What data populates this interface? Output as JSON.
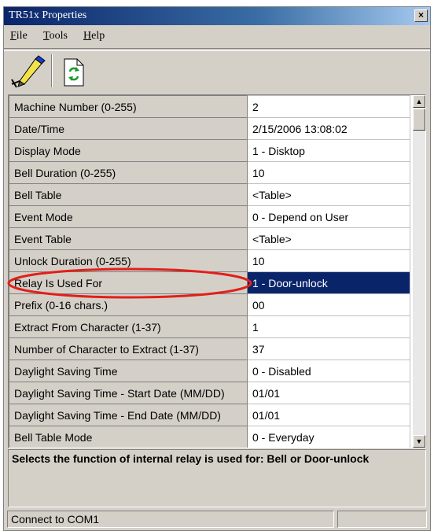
{
  "window": {
    "title": "TR51x Properties",
    "close_label": "×"
  },
  "menu": {
    "file_first": "F",
    "file_rest": "ile",
    "tools_first": "T",
    "tools_rest": "ools",
    "help_first": "H",
    "help_rest": "elp"
  },
  "toolbar": {
    "write_icon": "pen-writing-icon",
    "refresh_icon": "refresh-document-icon"
  },
  "properties": [
    {
      "name": "Machine Number (0-255)",
      "value": "2"
    },
    {
      "name": "Date/Time",
      "value": "2/15/2006 13:08:02"
    },
    {
      "name": "Display Mode",
      "value": "1 - Disktop"
    },
    {
      "name": "Bell Duration (0-255)",
      "value": "10"
    },
    {
      "name": "Bell Table",
      "value": "<Table>"
    },
    {
      "name": "Event Mode",
      "value": "0 - Depend on User"
    },
    {
      "name": "Event Table",
      "value": "<Table>"
    },
    {
      "name": "Unlock Duration (0-255)",
      "value": "10"
    },
    {
      "name": "Relay Is Used For",
      "value": "1 - Door-unlock",
      "selected": true
    },
    {
      "name": "Prefix (0-16 chars.)",
      "value": "00"
    },
    {
      "name": "Extract From Character (1-37)",
      "value": "1"
    },
    {
      "name": "Number of Character to Extract (1-37)",
      "value": "37"
    },
    {
      "name": "Daylight Saving Time",
      "value": "0 - Disabled"
    },
    {
      "name": "Daylight Saving Time - Start Date (MM/DD)",
      "value": "01/01"
    },
    {
      "name": "Daylight Saving Time - End Date (MM/DD)",
      "value": "01/01"
    },
    {
      "name": "Bell Table Mode",
      "value": "0 - Everyday"
    }
  ],
  "description": "Selects the function of internal relay is used for: Bell or Door-unlock",
  "status": {
    "connection": "Connect to COM1"
  },
  "colors": {
    "selection": "#0a246a",
    "highlight_ellipse": "#e0201a"
  }
}
